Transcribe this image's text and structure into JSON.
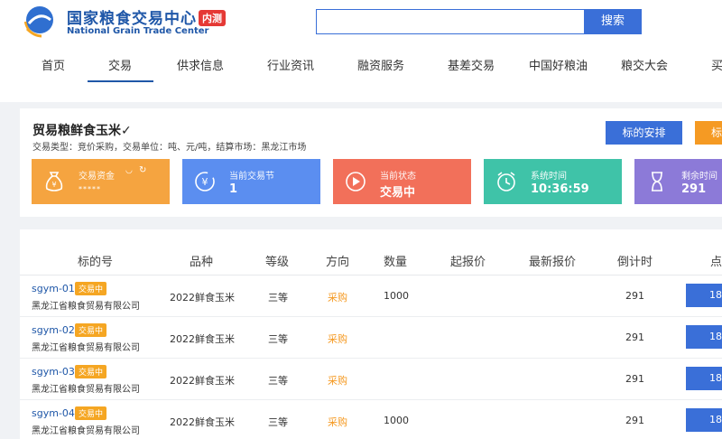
{
  "header": {
    "logo_cn": "国家粮食交易中心",
    "logo_badge": "内测",
    "logo_en": "National Grain Trade Center",
    "search_placeholder": "",
    "search_button": "搜索"
  },
  "nav": [
    "首页",
    "交易",
    "供求信息",
    "行业资讯",
    "融资服务",
    "基差交易",
    "中国好粮油",
    "粮交大会",
    "买"
  ],
  "nav_active": "交易",
  "trade": {
    "title": "贸易粮鲜食玉米✓",
    "subtitle": "交易类型：竞价采购，交易单位：吨、元/吨，结算市场：黑龙江市场",
    "btn_arrange": "标的安排",
    "btn_other": "标"
  },
  "stats": [
    {
      "label": "交易资金",
      "value": "*****",
      "color": "#f5a440",
      "icon": "money-bag-icon"
    },
    {
      "label": "当前交易节",
      "value": "1",
      "color": "#5b8ef0",
      "icon": "yen-cycle-icon"
    },
    {
      "label": "当前状态",
      "value": "交易中",
      "color": "#f2705a",
      "icon": "play-icon"
    },
    {
      "label": "系统时间",
      "value": "10:36:59",
      "color": "#3fc3a8",
      "icon": "alarm-clock-icon"
    },
    {
      "label": "剩余时间",
      "value": "291",
      "color": "#8c7ad8",
      "icon": "hourglass-icon"
    }
  ],
  "table": {
    "headers": [
      "标的号",
      "品种",
      "等级",
      "方向",
      "数量",
      "起报价",
      "最新报价",
      "倒计时",
      "点"
    ],
    "rows": [
      {
        "code": "sgym-01",
        "status": "交易中",
        "company": "黑龙江省粮食贸易有限公司",
        "variety": "2022鲜食玉米",
        "grade": "三等",
        "direction": "采购",
        "quantity": "1000",
        "start_price": "",
        "latest_price": "",
        "countdown": "291",
        "action": "18"
      },
      {
        "code": "sgym-02",
        "status": "交易中",
        "company": "黑龙江省粮食贸易有限公司",
        "variety": "2022鲜食玉米",
        "grade": "三等",
        "direction": "采购",
        "quantity": "",
        "start_price": "",
        "latest_price": "",
        "countdown": "291",
        "action": "18"
      },
      {
        "code": "sgym-03",
        "status": "交易中",
        "company": "黑龙江省粮食贸易有限公司",
        "variety": "2022鲜食玉米",
        "grade": "三等",
        "direction": "采购",
        "quantity": "",
        "start_price": "",
        "latest_price": "",
        "countdown": "291",
        "action": "18"
      },
      {
        "code": "sgym-04",
        "status": "交易中",
        "company": "黑龙江省粮食贸易有限公司",
        "variety": "2022鲜食玉米",
        "grade": "三等",
        "direction": "采购",
        "quantity": "1000",
        "start_price": "",
        "latest_price": "",
        "countdown": "291",
        "action": "18"
      }
    ]
  }
}
